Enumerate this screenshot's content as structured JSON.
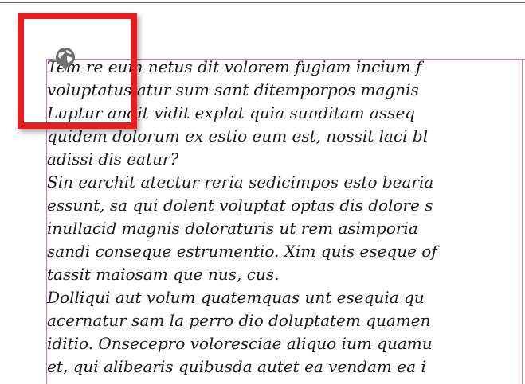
{
  "document": {
    "lines": [
      "Tem re eum netus dit volorem fugiam incium f",
      "voluptatus atur sum sant ditemporpos magnis",
      "Luptur andit vidit explat quia sunditam asseq",
      "quidem dolorum ex estio eum est, nossit laci bl",
      "adissi dis eatur?",
      "Sin earchit atectur reria sedicimpos esto bearia",
      "essunt, sa qui dolent voluptat optas dis dolore s",
      "inullacid magnis doloraturis ut rem asimporia",
      "sandi conseque estrumentio. Xim quis eseque of",
      "tassit maiosam que nus, cus.",
      "Dolliqui aut volum quatemquas unt esequia qu",
      "acernatur sam la perro dio doluptatem quamen",
      "iditio. Onsecepro voloresciae aliquo ium quamu",
      "et, qui alibearis quibusda autet ea vendam ea i"
    ]
  },
  "icons": {
    "globe": "globe-icon"
  },
  "colors": {
    "highlight": "#e41e1e",
    "frame_edge": "#c77bc7",
    "text": "#1a1a1a",
    "globe": "#6e6e6e"
  }
}
